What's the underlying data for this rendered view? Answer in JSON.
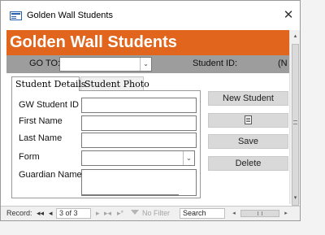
{
  "window": {
    "title": "Golden Wall Students",
    "icon": "form-icon",
    "close_glyph": "✕"
  },
  "header": {
    "title": "Golden Wall Students",
    "color": "#e1651c"
  },
  "goto_bar": {
    "label": "GO TO:",
    "combo_value": "",
    "dropdown_glyph": "⌄",
    "student_id_label": "Student ID:",
    "student_id_value": "(N"
  },
  "tabs": [
    {
      "label": "Student Details",
      "active": true
    },
    {
      "label": "Student Photo",
      "active": false
    }
  ],
  "fields": {
    "gw_student_id": {
      "label": "GW Student ID",
      "value": ""
    },
    "first_name": {
      "label": "First Name",
      "value": ""
    },
    "last_name": {
      "label": "Last Name",
      "value": ""
    },
    "form": {
      "label": "Form",
      "value": "",
      "dropdown_glyph": "⌄"
    },
    "guardian_name": {
      "label": "Guardian Name",
      "value": ""
    }
  },
  "buttons": {
    "new_student": "New Student",
    "save": "Save",
    "delete": "Delete"
  },
  "navigation": {
    "record_label": "Record:",
    "first_glyph": "◂◂",
    "prev_glyph": "◂",
    "position": "3 of 3",
    "next_glyph": "▸",
    "last_glyph": "▸◂",
    "new_glyph": "▸*",
    "filter_label": "No Filter",
    "search_placeholder": "Search",
    "scroll_left_glyph": "◂",
    "scroll_right_glyph": "▸"
  },
  "scrollbar": {
    "up_glyph": "▴",
    "down_glyph": "▾"
  }
}
